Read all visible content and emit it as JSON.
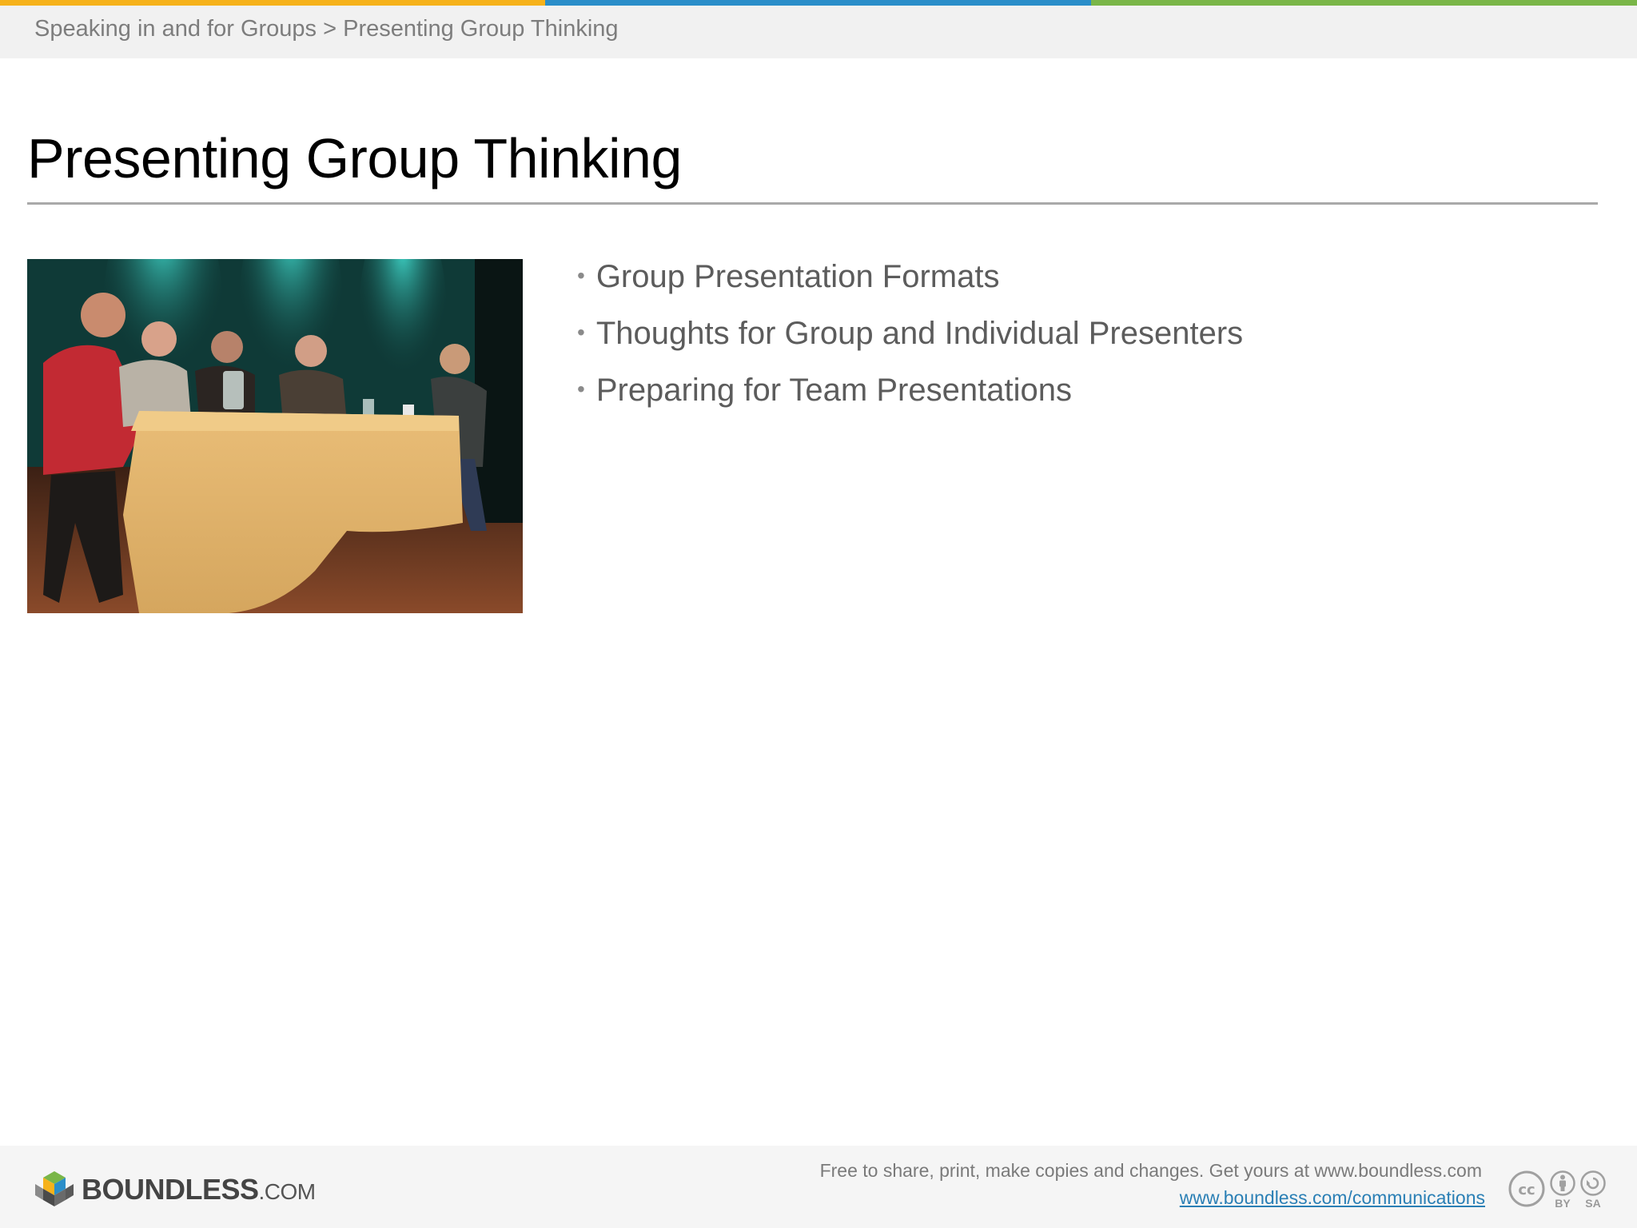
{
  "colors": {
    "bar_yellow": "#f6b21b",
    "bar_blue": "#2a8ec9",
    "bar_green": "#7ab648",
    "link": "#2a7fb5"
  },
  "breadcrumb": "Speaking in and for Groups > Presenting Group Thinking",
  "slide": {
    "title": "Presenting Group Thinking",
    "image_icon": "panel-discussion-photo",
    "bullets": [
      {
        "text": "Group Presentation Formats"
      },
      {
        "text": "Thoughts for Group and Individual Presenters"
      },
      {
        "text": "Preparing for Team Presentations"
      }
    ]
  },
  "footer": {
    "logo_name": "BOUNDLESS",
    "logo_suffix": ".COM",
    "share_text": "Free to share, print, make copies and changes. Get yours at www.boundless.com",
    "link_text": "www.boundless.com/communications",
    "license": {
      "by_label": "BY",
      "sa_label": "SA"
    }
  }
}
